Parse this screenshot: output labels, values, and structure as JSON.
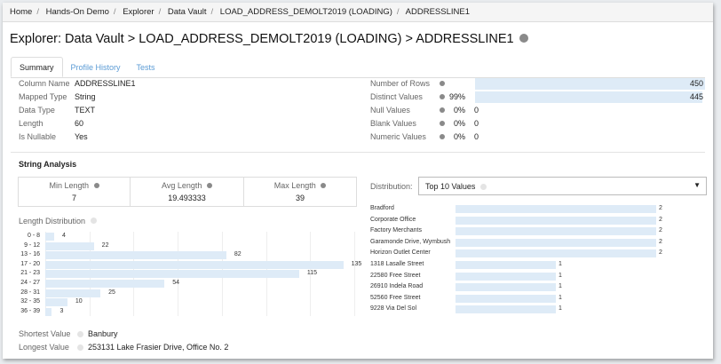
{
  "breadcrumb": [
    "Home",
    "Hands-On Demo",
    "Explorer",
    "Data Vault",
    "LOAD_ADDRESS_DEMOLT2019 (LOADING)",
    "ADDRESSLINE1"
  ],
  "title": "Explorer: Data Vault > LOAD_ADDRESS_DEMOLT2019 (LOADING) > ADDRESSLINE1",
  "tabs": [
    "Summary",
    "Profile History",
    "Tests"
  ],
  "properties": [
    {
      "label": "Column Name",
      "value": "ADDRESSLINE1"
    },
    {
      "label": "Mapped Type",
      "value": "String"
    },
    {
      "label": "Data Type",
      "value": "TEXT"
    },
    {
      "label": "Length",
      "value": "60"
    },
    {
      "label": "Is Nullable",
      "value": "Yes"
    }
  ],
  "stats": [
    {
      "label": "Number of Rows",
      "pct": "",
      "value": "450",
      "fraction": 1.0
    },
    {
      "label": "Distinct Values",
      "pct": "99%",
      "value": "445",
      "fraction": 0.989
    },
    {
      "label": "Null Values",
      "pct": "0%",
      "value": "0",
      "fraction": 0
    },
    {
      "label": "Blank Values",
      "pct": "0%",
      "value": "0",
      "fraction": 0
    },
    {
      "label": "Numeric Values",
      "pct": "0%",
      "value": "0",
      "fraction": 0
    }
  ],
  "string_analysis": {
    "heading": "String Analysis",
    "metrics": [
      {
        "label": "Min Length",
        "value": "7"
      },
      {
        "label": "Avg Length",
        "value": "19.493333"
      },
      {
        "label": "Max Length",
        "value": "39"
      }
    ],
    "length_distribution_label": "Length Distribution",
    "distribution_label": "Distribution:",
    "distribution_select": "Top 10 Values",
    "shortest_label": "Shortest Value",
    "shortest_value": "Banbury",
    "longest_label": "Longest Value",
    "longest_value": "253131 Lake Frasier Drive, Office No. 2"
  },
  "colors": {
    "bar": "#deebf7",
    "link": "#5b9bd5",
    "dot": "#8a8a8a"
  },
  "chart_data": [
    {
      "type": "bar",
      "orientation": "horizontal",
      "title": "Length Distribution",
      "categories": [
        "0 - 8",
        "9 - 12",
        "13 - 16",
        "17 - 20",
        "21 - 23",
        "24 - 27",
        "28 - 31",
        "32 - 35",
        "36 - 39"
      ],
      "values": [
        4,
        22,
        82,
        135,
        115,
        54,
        25,
        10,
        3
      ],
      "xlim": [
        0,
        140
      ]
    },
    {
      "type": "bar",
      "orientation": "horizontal",
      "title": "Top 10 Values",
      "categories": [
        "Bradford",
        "Corporate Office",
        "Factory Merchants",
        "Garamonde Drive, Wymbush",
        "Horizon Outlet Center",
        "1318 Lasalle Street",
        "22580 Free Street",
        "26910 Indela Road",
        "52560 Free Street",
        "9228 Via Del Sol"
      ],
      "values": [
        2,
        2,
        2,
        2,
        2,
        1,
        1,
        1,
        1,
        1
      ],
      "xlim": [
        0,
        2
      ]
    }
  ]
}
